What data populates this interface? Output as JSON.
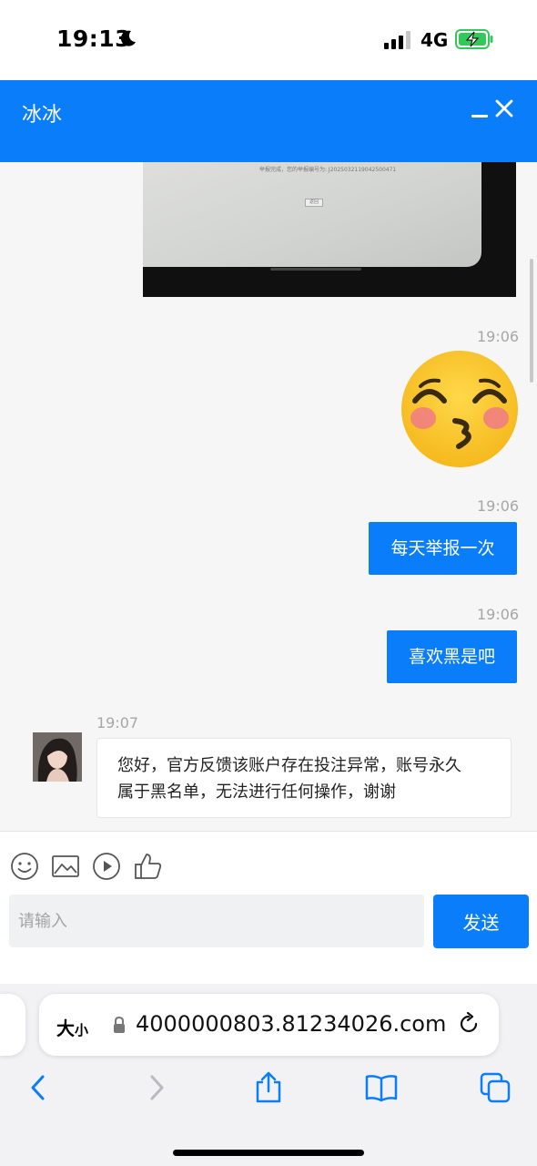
{
  "status_bar": {
    "time": "19:13",
    "network": "4G",
    "icons": [
      "moon-icon",
      "signal-icon",
      "battery-charging-icon"
    ]
  },
  "header": {
    "title": "冰冰",
    "actions": [
      "minimize-icon",
      "close-icon"
    ]
  },
  "messages": [
    {
      "from": "me",
      "type": "image",
      "image_text": "举报完成，您的举报编号为: J2025032119042500471",
      "image_button": "返回"
    },
    {
      "from": "me",
      "type": "sticker",
      "timestamp": "19:06",
      "sticker": "kissing-face-emoji"
    },
    {
      "from": "me",
      "type": "text",
      "timestamp": "19:06",
      "text": "每天举报一次"
    },
    {
      "from": "me",
      "type": "text",
      "timestamp": "19:06",
      "text": "喜欢黑是吧"
    },
    {
      "from": "agent",
      "type": "text",
      "timestamp": "19:07",
      "text_line1": "您好，官方反馈该账户存在投注异常，账号永久",
      "text_line2": "属于黑名单，无法进行任何操作，谢谢"
    }
  ],
  "composer": {
    "tools": [
      "emoji-icon",
      "image-icon",
      "video-icon",
      "thumbs-up-icon"
    ],
    "input_value": "",
    "placeholder": "请输入",
    "send_label": "发送"
  },
  "browser": {
    "text_size_big": "大",
    "text_size_small": "小",
    "url": "4000000803.81234026.com",
    "nav": [
      "back-icon",
      "forward-icon",
      "share-icon",
      "bookmarks-icon",
      "tabs-icon"
    ]
  },
  "colors": {
    "accent": "#0a7dfa",
    "background": "#f6f6f7",
    "timestamp": "#a6a6a6"
  }
}
